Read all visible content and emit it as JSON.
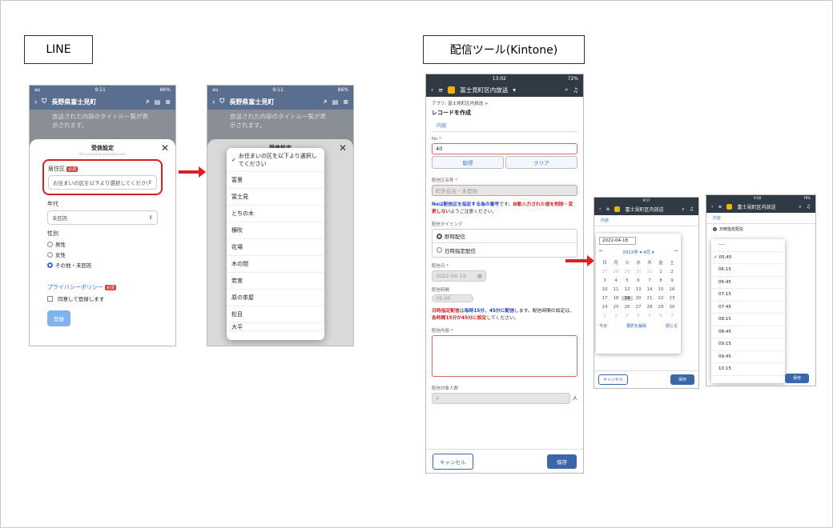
{
  "labels": {
    "line": "LINE",
    "kintone": "配信ツール(Kintone)"
  },
  "line": {
    "status": {
      "carrier": "au",
      "time": "9:11",
      "battery": "86%"
    },
    "header_title": "長野県富士見町",
    "broadcast_text": "放送された内容のタイトル一覧が表示されます。",
    "sheet_title": "受信設定",
    "sheet_small": "line.xxxxxxxx.xxxxxxxxx.xxx",
    "area_label": "居住区",
    "required": "必須",
    "area_value": "お住まいの区を以下より選択してください",
    "age_label": "年代",
    "age_value": "未回答",
    "gender_label": "性別",
    "genders": [
      "男性",
      "女性",
      "その他・未回答"
    ],
    "privacy_link": "プライバシーポリシー",
    "agree_text": "同意して登録します",
    "register_button": "登録",
    "dropdown_items": [
      "お住まいの区を以下より選択してください",
      "富里",
      "富士見",
      "とちの木",
      "横吹",
      "花場",
      "木の間",
      "若宮",
      "原の茶屋",
      "松目",
      "大平"
    ]
  },
  "kintone": {
    "status": {
      "time": "13:02",
      "battery": "72%"
    },
    "app_title": "富士見町区内放送",
    "breadcrumb": "アプリ: 富士見町区内放送 >",
    "page_title": "レコードを作成",
    "tab": "内容",
    "no_label": "No *",
    "no_value": "40",
    "get_button": "取得",
    "clear_button": "クリア",
    "area_label": "配信区名称 *",
    "area_value": "町外在住・未登録",
    "note1_a": "Noは配信区を指定する為の番号",
    "note1_b": "です。",
    "note1_c": "自動入力された値を削除・変更しない",
    "note1_d": "ようご注意ください。",
    "timing_label": "配信タイミング",
    "timing_opt1": "即時配信",
    "timing_opt2": "日時指定配信",
    "date_label": "配信日 *",
    "date_value": "2022-04-19",
    "time_label": "配信時間",
    "time_value": "05:45",
    "note2_a": "日時指定配信",
    "note2_b": "は",
    "note2_c": "毎時15分、45分に配信",
    "note2_d": "します。配信時間の設定は、",
    "note2_e": "各時間15分か45分に設定",
    "note2_f": "してください。",
    "content_label": "配信内容 *",
    "count_label": "配信対象人数",
    "count_value": "0",
    "count_unit": "人",
    "cancel_button": "キャンセル",
    "save_button": "保存"
  },
  "calendar": {
    "status": {
      "time": "9:57"
    },
    "tab": "内容",
    "date_value": "2022-04-18",
    "month_label": "2022年 ▾ 4月 ▾",
    "weekdays": [
      "日",
      "月",
      "火",
      "水",
      "木",
      "金",
      "土"
    ],
    "days": [
      "27",
      "28",
      "29",
      "30",
      "31",
      "1",
      "2",
      "3",
      "4",
      "5",
      "6",
      "7",
      "8",
      "9",
      "10",
      "11",
      "12",
      "13",
      "14",
      "15",
      "16",
      "17",
      "18",
      "19",
      "20",
      "21",
      "22",
      "23",
      "24",
      "25",
      "26",
      "27",
      "28",
      "29",
      "30",
      "1",
      "2",
      "3",
      "4",
      "5",
      "6",
      "7"
    ],
    "today_btn": "今日",
    "clear_btn": "選択を解除",
    "close_btn": "閉じる",
    "cancel_button": "キャンセル",
    "save_button": "保存"
  },
  "timepicker": {
    "status": {
      "time": "9:58",
      "battery": "79%"
    },
    "tab": "内容",
    "selected_opt": "日時指定配信",
    "times": [
      "----",
      "05:45",
      "06:15",
      "06:45",
      "07:15",
      "07:45",
      "08:15",
      "08:45",
      "09:15",
      "09:45",
      "10:15"
    ],
    "save_button": "保存"
  }
}
